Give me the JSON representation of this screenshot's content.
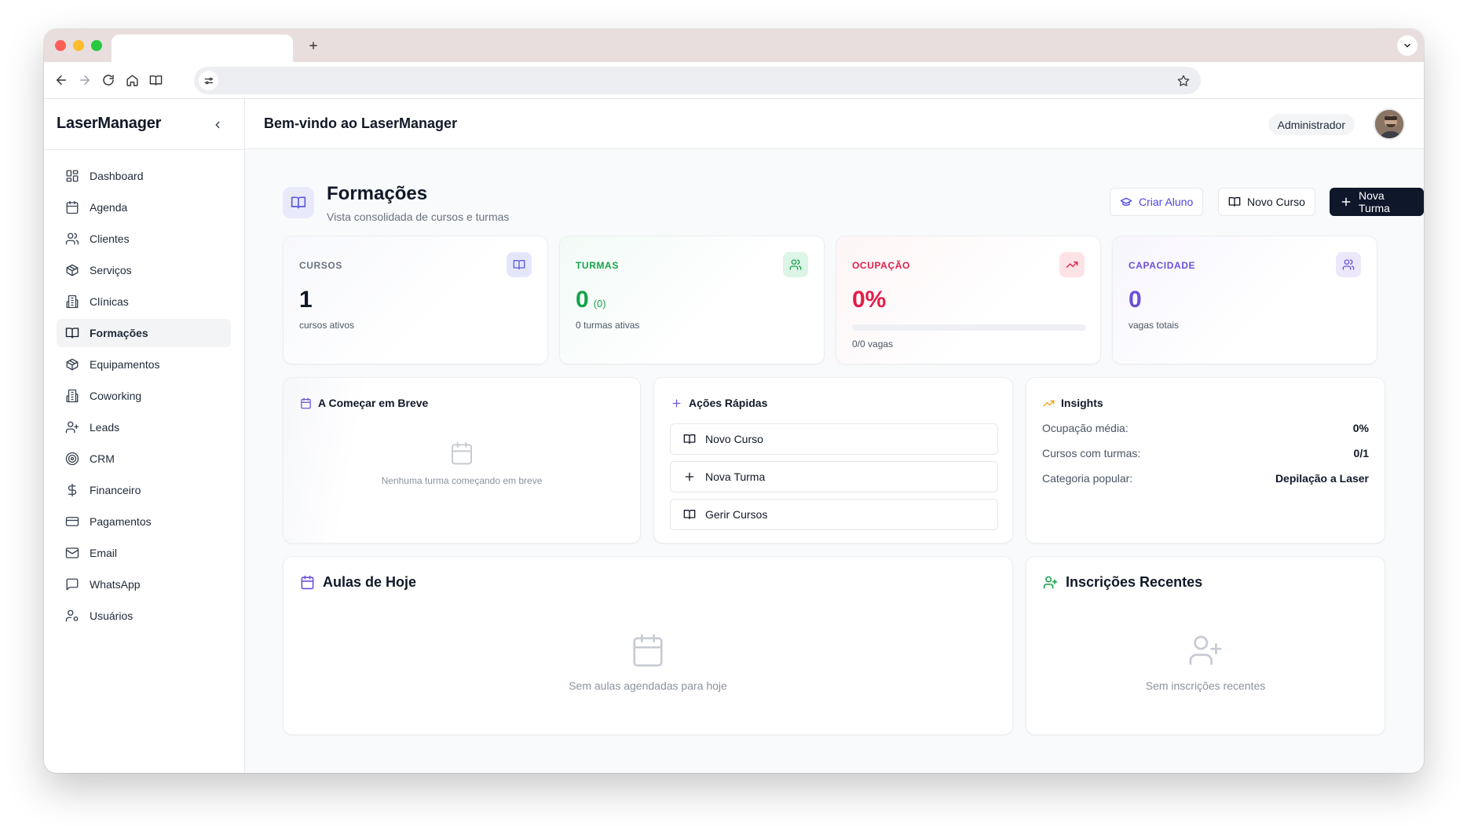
{
  "app": {
    "brand": "LaserManager",
    "welcome": "Bem-vindo ao LaserManager",
    "role": "Administrador"
  },
  "sidebar": {
    "items": [
      {
        "label": "Dashboard",
        "icon": "layout-grid-icon"
      },
      {
        "label": "Agenda",
        "icon": "calendar-icon"
      },
      {
        "label": "Clientes",
        "icon": "users-icon"
      },
      {
        "label": "Serviços",
        "icon": "package-icon"
      },
      {
        "label": "Clínicas",
        "icon": "building-icon"
      },
      {
        "label": "Formações",
        "icon": "book-open-icon",
        "active": true
      },
      {
        "label": "Equipamentos",
        "icon": "package-icon"
      },
      {
        "label": "Coworking",
        "icon": "building-icon"
      },
      {
        "label": "Leads",
        "icon": "user-plus-icon"
      },
      {
        "label": "CRM",
        "icon": "target-icon"
      },
      {
        "label": "Financeiro",
        "icon": "dollar-icon"
      },
      {
        "label": "Pagamentos",
        "icon": "credit-card-icon"
      },
      {
        "label": "Email",
        "icon": "mail-icon"
      },
      {
        "label": "WhatsApp",
        "icon": "message-icon"
      },
      {
        "label": "Usuários",
        "icon": "user-cog-icon"
      }
    ]
  },
  "page": {
    "title": "Formações",
    "subtitle": "Vista consolidada de cursos e turmas",
    "actions": {
      "criar_aluno": "Criar Aluno",
      "novo_curso": "Novo Curso",
      "nova_turma": "Nova Turma"
    }
  },
  "stats": {
    "cursos": {
      "label": "CURSOS",
      "value": "1",
      "desc": "cursos ativos",
      "color": "#6b7280"
    },
    "turmas": {
      "label": "TURMAS",
      "value": "0",
      "value_sub": "(0)",
      "desc": "0 turmas ativas",
      "color": "#16a34a"
    },
    "ocupacao": {
      "label": "OCUPAÇÃO",
      "value": "0%",
      "desc": "0/0 vagas",
      "progress": 0,
      "color": "#e11d48"
    },
    "capacidade": {
      "label": "CAPACIDADE",
      "value": "0",
      "desc": "vagas totais",
      "color": "#6d4fd8"
    }
  },
  "breve": {
    "title": "A Começar em Breve",
    "empty": "Nenhuma turma começando em breve"
  },
  "acoes": {
    "title": "Ações Rápidas",
    "items": [
      "Novo Curso",
      "Nova Turma",
      "Gerir Cursos"
    ]
  },
  "insights": {
    "title": "Insights",
    "rows": [
      {
        "key": "Ocupação média:",
        "value": "0%"
      },
      {
        "key": "Cursos com turmas:",
        "value": "0/1"
      },
      {
        "key": "Categoria popular:",
        "value": "Depilação a Laser"
      }
    ]
  },
  "aulas": {
    "title": "Aulas de Hoje",
    "empty": "Sem aulas agendadas para hoje"
  },
  "inscricoes": {
    "title": "Inscrições Recentes",
    "empty": "Sem inscrições recentes"
  }
}
